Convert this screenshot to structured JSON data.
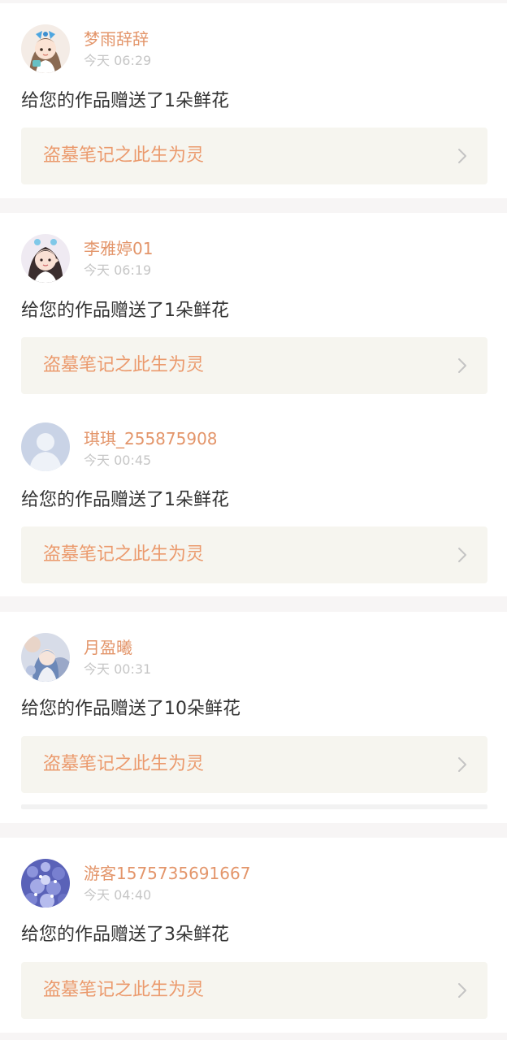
{
  "work_title": "盗墓笔记之此生为灵",
  "colors": {
    "page_bg": "#f7f5f5",
    "card_bg": "#ffffff",
    "name": "#e3956a",
    "time": "#c6c6c6",
    "message": "#333333",
    "work_box_bg": "#f6f5ef",
    "work_title": "#eb9a6d",
    "chevron": "#c4c4c4"
  },
  "notifications": [
    {
      "user": "梦雨辞辞",
      "time": "今天 06:29",
      "message": "给您的作品赠送了1朵鲜花",
      "work": "盗墓笔记之此生为灵",
      "avatar_icon": "anime-girl-avatar-icon"
    },
    {
      "user": "李雅婷01",
      "time": "今天 06:19",
      "message": "给您的作品赠送了1朵鲜花",
      "work": "盗墓笔记之此生为灵",
      "avatar_icon": "girl-photo-avatar-icon"
    },
    {
      "user": "琪琪_255875908",
      "time": "今天 00:45",
      "message": "给您的作品赠送了1朵鲜花",
      "work": "盗墓笔记之此生为灵",
      "avatar_icon": "default-user-avatar-icon"
    },
    {
      "user": "月盈曦",
      "time": "今天 00:31",
      "message": "给您的作品赠送了10朵鲜花",
      "work": "盗墓笔记之此生为灵",
      "avatar_icon": "portrait-avatar-icon"
    },
    {
      "user": "游客1575735691667",
      "time": "今天 04:40",
      "message": "给您的作品赠送了3朵鲜花",
      "work": "盗墓笔记之此生为灵",
      "avatar_icon": "blue-flowers-avatar-icon"
    }
  ]
}
